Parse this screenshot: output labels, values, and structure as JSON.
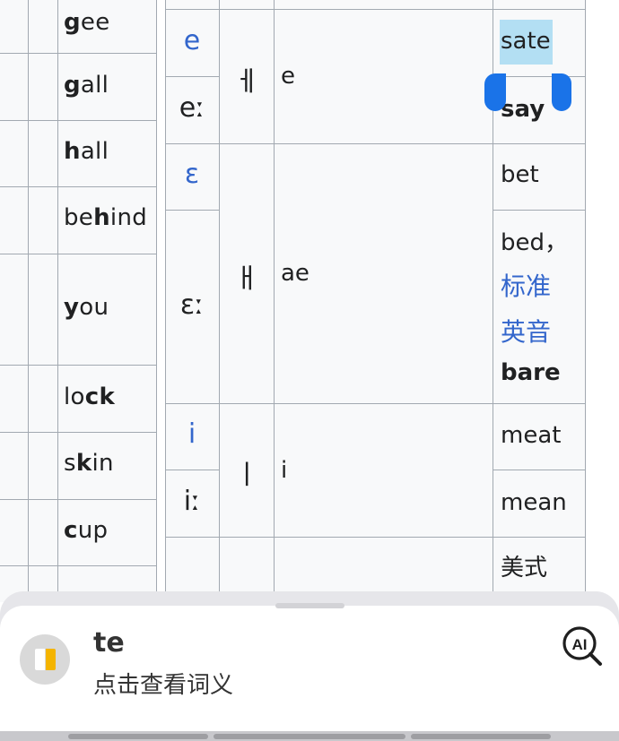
{
  "left_table": {
    "rows": [
      {
        "pre": "",
        "bold": "g",
        "post": "ee"
      },
      {
        "pre": "",
        "bold": "g",
        "post": "all"
      },
      {
        "pre": "",
        "bold": "h",
        "post": "all"
      },
      {
        "pre": "be",
        "bold": "h",
        "post": "ind"
      },
      {
        "pre": "",
        "bold": "y",
        "post": "ou"
      },
      {
        "pre": "lo",
        "bold": "ck",
        "post": ""
      },
      {
        "pre": "s",
        "bold": "k",
        "post": "in"
      },
      {
        "pre": "",
        "bold": "c",
        "post": "up"
      }
    ]
  },
  "right_table": {
    "groups": [
      {
        "ipa": [
          "e",
          "eː"
        ],
        "symbol": "ㅔ",
        "roman": "e",
        "examples": [
          "sate",
          "say"
        ]
      },
      {
        "ipa": [
          "ɛ",
          "ɛː"
        ],
        "symbol": "ㅐ",
        "roman": "ae",
        "examples": [
          "bet",
          "bed，",
          "标准",
          "英音",
          "bare"
        ]
      },
      {
        "ipa": [
          "i",
          "iː"
        ],
        "symbol": "ㅣ",
        "roman": "i",
        "examples": [
          "meat",
          "mean"
        ]
      },
      {
        "ipa": [],
        "symbol": "",
        "roman": "",
        "examples": [
          "美式"
        ]
      }
    ],
    "selected_text": "sate"
  },
  "lookup_sheet": {
    "word": "te",
    "hint": "点击查看词义",
    "icons": {
      "dictionary": "book-icon",
      "ai": "ai-search-icon"
    }
  },
  "colors": {
    "link": "#3366cc",
    "selection": "#b3dff3",
    "handle": "#1a73e8",
    "cell_bg": "#f8f9fa",
    "border": "#a2a9b1"
  }
}
